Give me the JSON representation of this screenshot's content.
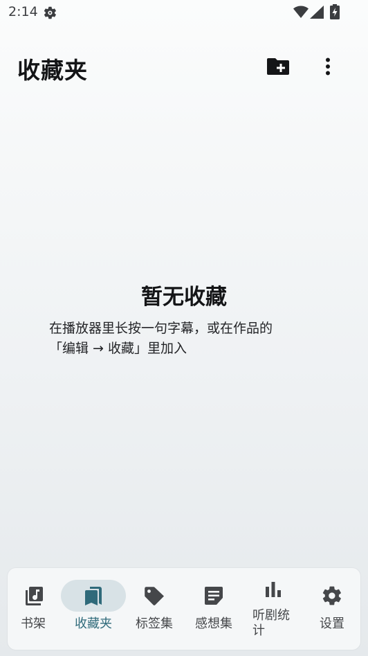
{
  "status_bar": {
    "time": "2:14",
    "icons": [
      "gear-icon",
      "wifi-icon",
      "signal-icon",
      "battery-charging-icon"
    ]
  },
  "header": {
    "title": "收藏夹",
    "actions": [
      {
        "name": "new-folder",
        "icon": "create-new-folder-icon"
      },
      {
        "name": "more",
        "icon": "more-vertical-icon"
      }
    ]
  },
  "empty_state": {
    "title": "暂无收藏",
    "description_line1": "在播放器里长按一句字幕，或在作品的",
    "description_line2": "「编辑 → 收藏」里加入"
  },
  "bottom_nav": {
    "active_index": 1,
    "accent_color": "#2f6a7a",
    "pill_color": "#d8e2e6",
    "items": [
      {
        "label": "书架",
        "icon": "music-library-icon"
      },
      {
        "label": "收藏夹",
        "icon": "bookmarks-icon"
      },
      {
        "label": "标签集",
        "icon": "tag-icon"
      },
      {
        "label": "感想集",
        "icon": "note-icon"
      },
      {
        "label_line1": "听剧统",
        "label_line2": "计",
        "icon": "bar-chart-icon"
      },
      {
        "label": "设置",
        "icon": "settings-icon"
      }
    ]
  }
}
